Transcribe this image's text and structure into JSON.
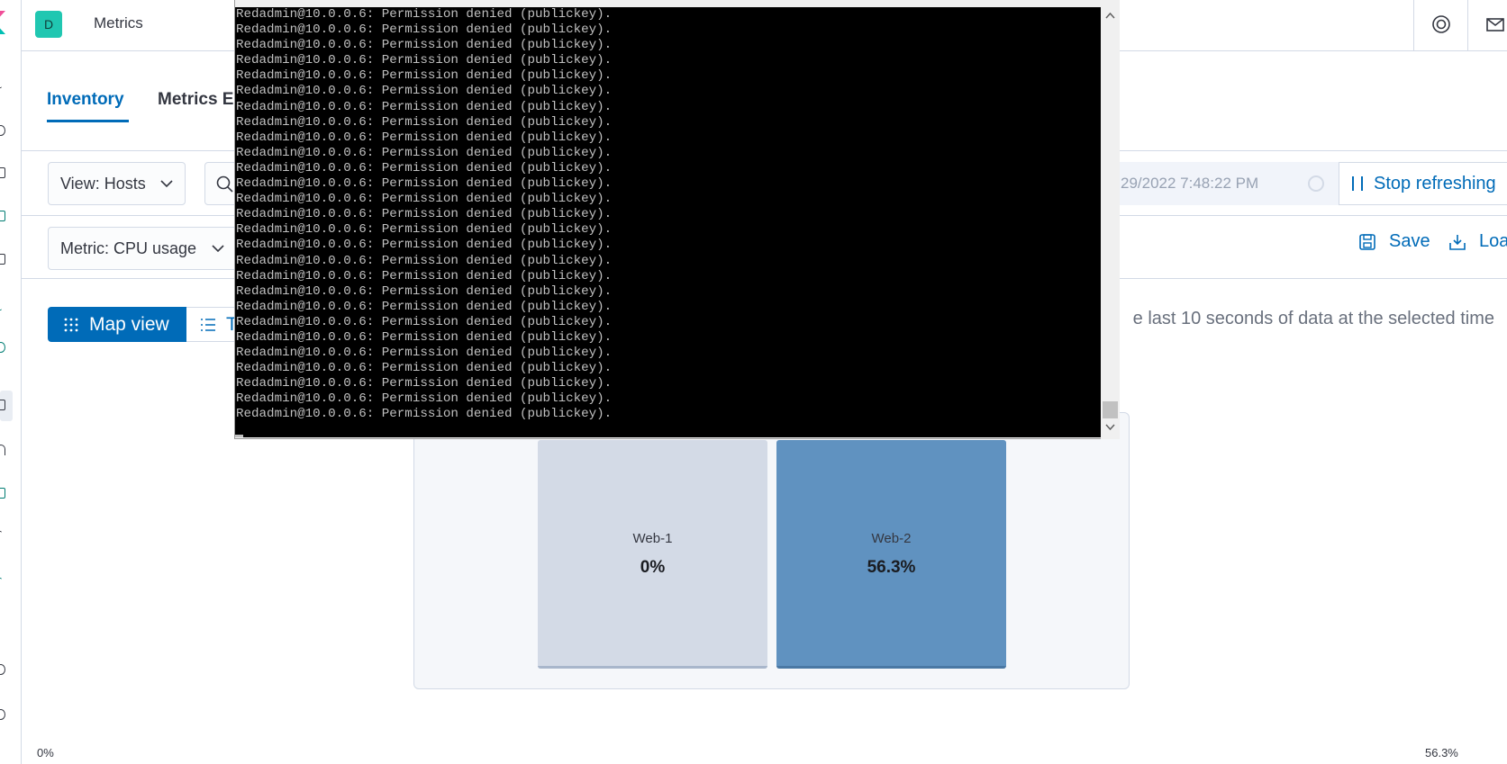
{
  "app": {
    "space_initial": "D",
    "title": "Metrics"
  },
  "tabs": [
    {
      "label": "Inventory",
      "active": true
    },
    {
      "label": "Metrics E",
      "active": false
    }
  ],
  "toolbar": {
    "view_select": "View: Hosts",
    "metric_select": "Metric: CPU usage",
    "date_text": "29/2022 7:48:22 PM",
    "stop_refresh_label": "Stop refreshing",
    "save_label": "Save",
    "load_label": "Load"
  },
  "view_toggle": {
    "map_label": "Map view",
    "table_label": "T"
  },
  "info_text": "e last 10 seconds of data at the selected time",
  "nodes": [
    {
      "name": "Web-1",
      "value": "0%"
    },
    {
      "name": "Web-2",
      "value": "56.3%"
    }
  ],
  "legend": {
    "min": "0%",
    "max": "56.3%"
  },
  "terminal": {
    "line_text": "Redadmin@10.0.0.6: Permission denied (publickey).",
    "line_count": 27
  },
  "colors": {
    "accent": "#006bb8",
    "space_badge": "#20c7b1",
    "node_low": "#d3dae6",
    "node_high": "#6092c0",
    "terminal_bg": "#000000",
    "terminal_fg": "#c0c0c0"
  }
}
